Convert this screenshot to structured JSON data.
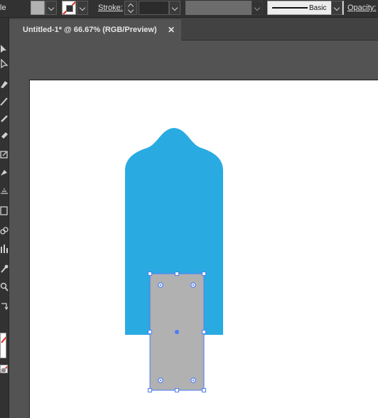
{
  "control_bar": {
    "left_label": "le",
    "fill_color": "#b1b1b1",
    "stroke_label": "Stroke:",
    "stroke_weight": "",
    "profile_label": "Basic",
    "opacity_label": "Opacity:"
  },
  "tools": {
    "items": [
      "selection-tool",
      "direct-selection-tool",
      "pen-tool",
      "pencil-tool",
      "brush-tool",
      "eraser-tool",
      "scale-tool",
      "width-tool",
      "shape-builder-tool",
      "perspective-grid-tool",
      "mesh-tool",
      "gradient-tool",
      "eyedropper-tool",
      "blend-tool",
      "symbol-sprayer-tool",
      "column-graph-tool",
      "artboard-tool",
      "zoom-tool",
      "swap-icon"
    ]
  },
  "document": {
    "tab_title": "Untitled-1* @ 66.67% (RGB/Preview)",
    "close_label": "✕"
  },
  "artwork": {
    "blue_shape_color": "#29abe2",
    "selected_rect_fill": "#b1b1b1",
    "selection_color": "#4a7cf7"
  }
}
